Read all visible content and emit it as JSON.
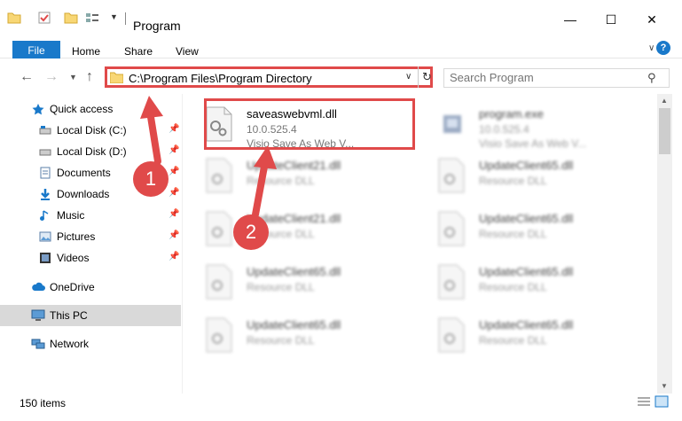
{
  "window": {
    "title": "Program",
    "minimize": "—",
    "maximize": "☐",
    "close": "✕"
  },
  "ribbon": {
    "file": "File",
    "home": "Home",
    "share": "Share",
    "view": "View",
    "help": "?"
  },
  "nav": {
    "address": "C:\\Program Files\\Program Directory",
    "search_placeholder": "Search Program"
  },
  "sidebar": {
    "items": [
      {
        "label": "Quick access",
        "icon": "star-icon",
        "pinned": false
      },
      {
        "label": "Local Disk (C:)",
        "icon": "drive-icon",
        "pinned": true
      },
      {
        "label": "Local Disk (D:)",
        "icon": "drive-icon",
        "pinned": true
      },
      {
        "label": "Documents",
        "icon": "documents-icon",
        "pinned": true
      },
      {
        "label": "Downloads",
        "icon": "download-icon",
        "pinned": true
      },
      {
        "label": "Music",
        "icon": "music-icon",
        "pinned": true
      },
      {
        "label": "Pictures",
        "icon": "pictures-icon",
        "pinned": true
      },
      {
        "label": "Videos",
        "icon": "videos-icon",
        "pinned": true
      },
      {
        "label": "OneDrive",
        "icon": "cloud-icon",
        "pinned": false
      },
      {
        "label": "This PC",
        "icon": "computer-icon",
        "pinned": false,
        "selected": true
      },
      {
        "label": "Network",
        "icon": "network-icon",
        "pinned": false
      }
    ]
  },
  "files": [
    {
      "name": "saveaswebvml.dll",
      "line1": "10.0.525.4",
      "line2": "Visio Save As Web V...",
      "highlighted": true
    },
    {
      "name": "program.exe",
      "line1": "10.0.525.4",
      "line2": "Visio Save As Web V..."
    },
    {
      "name": "UpdateClient21.dll",
      "line1": "Resource DLL"
    },
    {
      "name": "UpdateClient65.dll",
      "line1": "Resource DLL"
    },
    {
      "name": "UpdateClient21.dll",
      "line1": "Resource DLL"
    },
    {
      "name": "UpdateClient65.dll",
      "line1": "Resource DLL"
    },
    {
      "name": "UpdateClient65.dll",
      "line1": "Resource DLL"
    },
    {
      "name": "UpdateClient65.dll",
      "line1": "Resource DLL"
    },
    {
      "name": "UpdateClient65.dll",
      "line1": "Resource DLL"
    },
    {
      "name": "UpdateClient65.dll",
      "line1": "Resource DLL"
    }
  ],
  "status": {
    "items_count": "150 items"
  },
  "callouts": {
    "one": "1",
    "two": "2"
  },
  "colors": {
    "accent": "#1979ca",
    "annotation": "#e04a4a"
  }
}
